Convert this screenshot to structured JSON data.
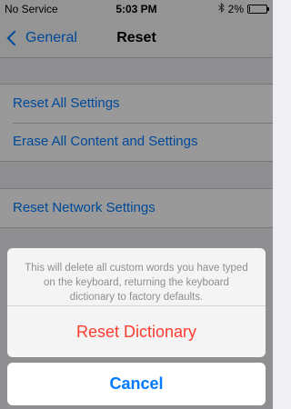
{
  "status_bar": {
    "carrier": "No Service",
    "time": "5:03 PM",
    "battery": "2%",
    "battery_level": 0.02
  },
  "nav": {
    "back_label": "General",
    "title": "Reset"
  },
  "groups": [
    {
      "items": [
        "Reset All Settings",
        "Erase All Content and Settings"
      ]
    },
    {
      "items": [
        "Reset Network Settings"
      ]
    }
  ],
  "action_sheet": {
    "message": "This will delete all custom words you have typed on the keyboard, returning the keyboard dictionary to factory defaults.",
    "destructive_label": "Reset Dictionary",
    "cancel_label": "Cancel"
  },
  "colors": {
    "accent": "#007aff",
    "destructive": "#ff3b30",
    "background": "#efeff4"
  },
  "icons": [
    "bluetooth-icon",
    "battery-icon",
    "back-chevron-icon"
  ]
}
